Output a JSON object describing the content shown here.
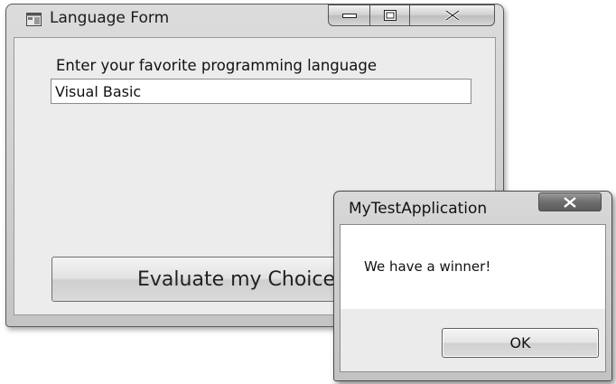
{
  "language_form": {
    "title": "Language Form",
    "icon": "form-window-icon",
    "caption_buttons": [
      "minimize-icon",
      "maximize-icon",
      "close-icon"
    ],
    "prompt_label": "Enter your favorite programming language",
    "language_input_value": "Visual Basic",
    "evaluate_button_label": "Evaluate my Choice"
  },
  "message_box": {
    "title": "MyTestApplication",
    "message": "We have a winner!",
    "ok_label": "OK",
    "close_icon": "close-icon"
  }
}
